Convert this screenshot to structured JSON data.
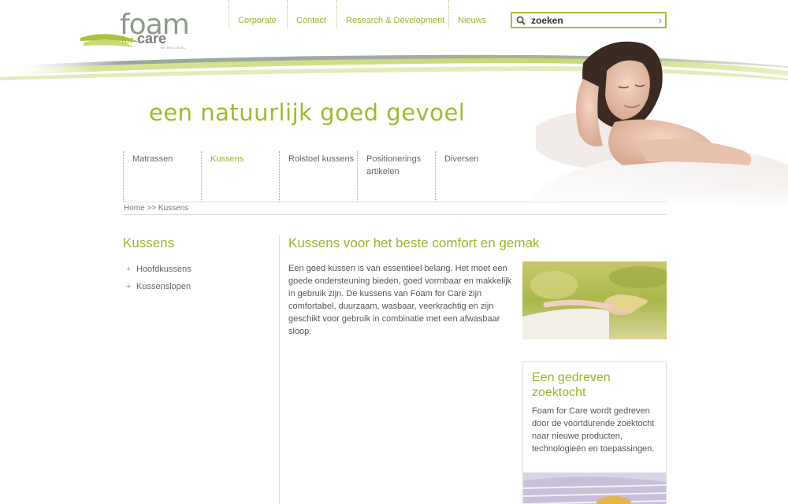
{
  "logo": {
    "word1": "foam",
    "word2": "for",
    "word3": "care",
    "byline": "BY RECTICEL"
  },
  "topnav": {
    "items": [
      "Corporate",
      "Contact",
      "Research & Development",
      "Nieuws"
    ]
  },
  "search": {
    "value": "zoeken",
    "icon": "search-icon",
    "submit_icon": "chevron-right-icon"
  },
  "slogan": "een natuurlijk goed gevoel",
  "mainnav": {
    "items": [
      "Matrassen",
      "Kussens",
      "Rolstoel kussens",
      "Positionerings artikelen",
      "Diversen"
    ],
    "active": "Kussens"
  },
  "breadcrumb": "Home >> Kussens",
  "sidebar": {
    "title": "Kussens",
    "items": [
      "Hoofdkussens",
      "Kussenslopen"
    ]
  },
  "content": {
    "title": "Kussens voor het beste comfort en gemak",
    "text": "Een goed kussen is van essentieel belang. Het moet een goede ondersteuning bieden, goed vormbaar en makkelijk in gebruik zijn. De kussens van Foam for Care zijn comfortabel, duurzaam, wasbaar, veerkrachtig en zijn geschikt voor gebruik in combinatie met een afwasbaar sloop."
  },
  "promo": {
    "title": "Een gedreven zoektocht",
    "text": "Foam for Care wordt gedreven door de voortdurende zoektocht naar nieuwe producten, technologieën en toepassingen."
  },
  "colors": {
    "accent": "#9fb22c",
    "text": "#555555",
    "divider": "#dddddd"
  }
}
